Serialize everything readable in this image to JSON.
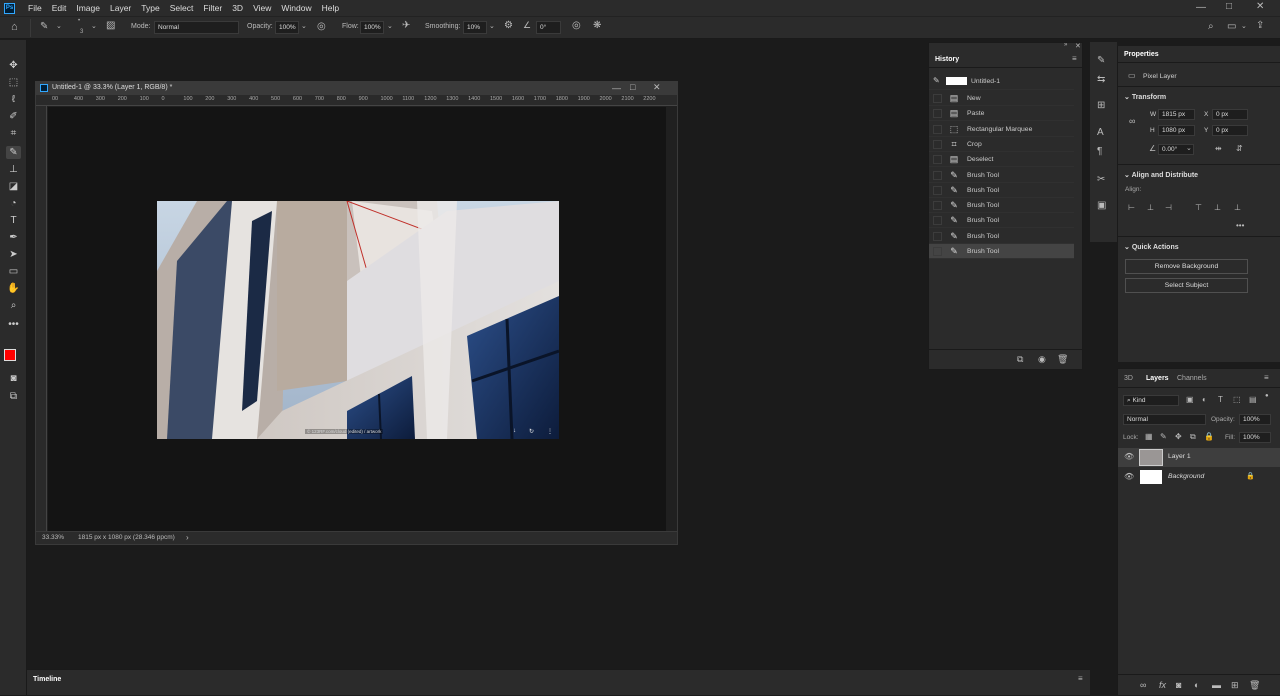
{
  "menubar": {
    "logo": "Ps",
    "items": [
      "File",
      "Edit",
      "Image",
      "Layer",
      "Type",
      "Select",
      "Filter",
      "3D",
      "View",
      "Window",
      "Help"
    ]
  },
  "options": {
    "mode_label": "Mode:",
    "mode_value": "Normal",
    "opacity_label": "Opacity:",
    "opacity_value": "100%",
    "flow_label": "Flow:",
    "flow_value": "100%",
    "smoothing_label": "Smoothing:",
    "smoothing_value": "10%",
    "angle_value": "0°",
    "brush_size": "3"
  },
  "document": {
    "title": "Untitled-1 @ 33.3% (Layer 1, RGB/8) *",
    "zoom": "33.33%",
    "info": "1815 px x 1080 px (28.346 ppcm)",
    "ruler_marks": [
      "00",
      "400",
      "300",
      "200",
      "100",
      "0",
      "100",
      "200",
      "300",
      "400",
      "500",
      "600",
      "700",
      "800",
      "900",
      "1000",
      "1100",
      "1200",
      "1300",
      "1400",
      "1500",
      "1600",
      "1700",
      "1800",
      "1900",
      "2000",
      "2100",
      "2200"
    ],
    "image_caption": "© 123RF.com/cloud (edited) / artwork",
    "image_background": "#8e8a88"
  },
  "history": {
    "title": "History",
    "snapshot": "Untitled-1",
    "items": [
      "New",
      "Paste",
      "Rectangular Marquee",
      "Crop",
      "Deselect",
      "Brush Tool",
      "Brush Tool",
      "Brush Tool",
      "Brush Tool",
      "Brush Tool",
      "Brush Tool"
    ]
  },
  "properties": {
    "title": "Properties",
    "kind": "Pixel Layer",
    "transform_title": "Transform",
    "w_label": "W",
    "w_value": "1815 px",
    "h_label": "H",
    "h_value": "1080 px",
    "x_label": "X",
    "x_value": "0 px",
    "y_label": "Y",
    "y_value": "0 px",
    "angle": "0.00°",
    "align_title": "Align and Distribute",
    "align_label": "Align:",
    "quick_title": "Quick Actions",
    "remove_bg": "Remove Background",
    "select_subject": "Select Subject"
  },
  "layers": {
    "tabs": [
      "3D",
      "Layers",
      "Channels"
    ],
    "kind_filter": "Kind",
    "blend_mode": "Normal",
    "opacity_label": "Opacity:",
    "opacity_value": "100%",
    "lock_label": "Lock:",
    "fill_label": "Fill:",
    "fill_value": "100%",
    "items": [
      {
        "name": "Layer 1"
      },
      {
        "name": "Background"
      }
    ]
  },
  "timeline": {
    "label": "Timeline"
  },
  "colors": {
    "foreground": "#ff0000",
    "background": "#ffffff",
    "panel": "#2b2b2b",
    "accent": "#31a8ff"
  }
}
